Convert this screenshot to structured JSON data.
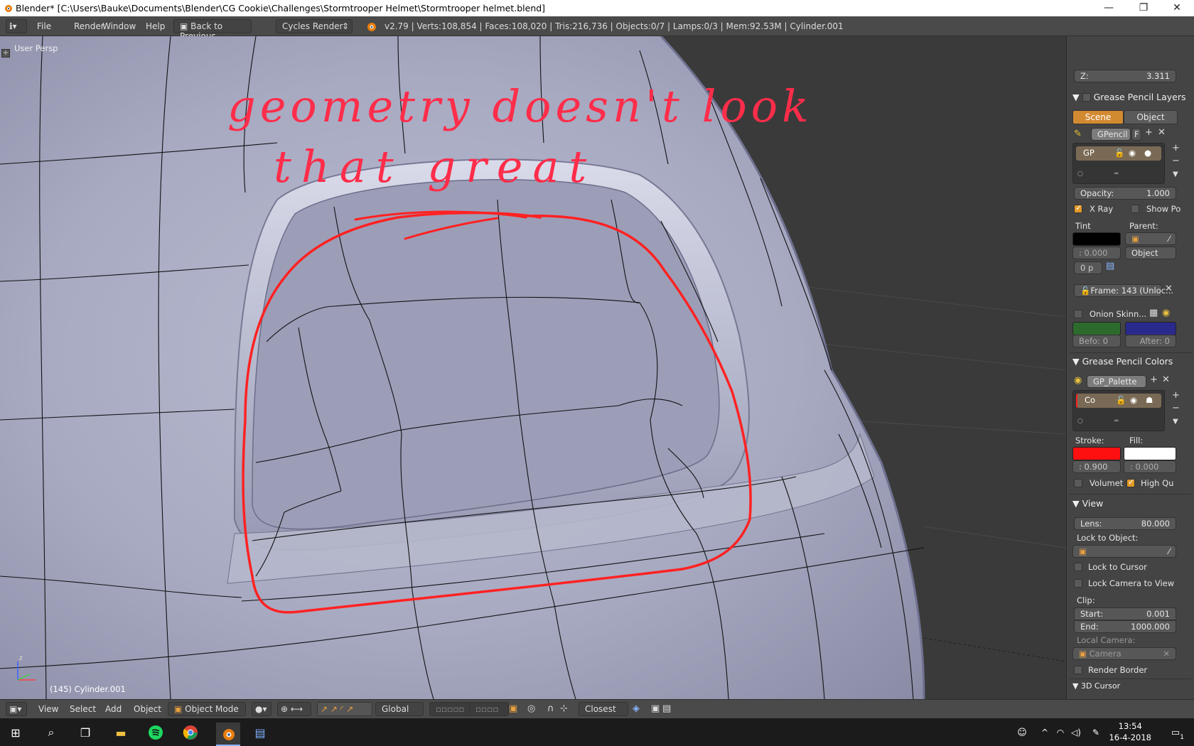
{
  "window": {
    "title": "Blender* [C:\\Users\\Bauke\\Documents\\Blender\\CG Cookie\\Challenges\\Stormtrooper Helmet\\Stormtrooper helmet.blend]",
    "minimize": "—",
    "maximize": "❐",
    "close": "✕"
  },
  "info_header": {
    "menus": [
      "File",
      "Render",
      "Window",
      "Help"
    ],
    "back_button": "Back to Previous",
    "engine": "Cycles Render",
    "stats": "v2.79 | Verts:108,854 | Faces:108,020 | Tris:216,736 | Objects:0/7 | Lamps:0/3 | Mem:92.53M | Cylinder.001"
  },
  "viewport": {
    "persp_label": "User Persp",
    "object_label": "(145) Cylinder.001",
    "annotation_line1": "geometry doesn't look",
    "annotation_line2": "that great",
    "stroke_color": "#ff2222"
  },
  "properties": {
    "z_field": {
      "label": "Z:",
      "value": "3.311"
    },
    "gp_layers": {
      "header": "Grease Pencil Layers",
      "tab_scene": "Scene",
      "tab_object": "Object",
      "datablock": "GPencil",
      "datablock_f": "F",
      "layer_name": "GP",
      "opacity_label": "Opacity:",
      "opacity_value": "1.000",
      "xray_label": "X Ray",
      "show_points_label": "Show Po",
      "tint_label": "Tint",
      "parent_label": "Parent:",
      "tint_value": ": 0.000",
      "parent_type": "Object",
      "thickness_value": "0 p",
      "frame_label": "Frame: 143 (Unloc...",
      "onion_label": "Onion Skinn...",
      "before_label": "Befo: 0",
      "after_label": "After: 0"
    },
    "gp_colors": {
      "header": "Grease Pencil Colors",
      "palette": "GP_Palette",
      "color_name": "Co",
      "stroke_label": "Stroke:",
      "fill_label": "Fill:",
      "stroke_alpha": ": 0.900",
      "fill_alpha": ": 0.000",
      "stroke_color": "#ff1010",
      "fill_color": "#ffffff",
      "volumetric_label": "Volumet",
      "high_quality_label": "High Qu"
    },
    "view": {
      "header": "View",
      "lens_label": "Lens:",
      "lens_value": "80.000",
      "lock_object_label": "Lock to Object:",
      "lock_cursor_label": "Lock to Cursor",
      "lock_camera_label": "Lock Camera to View",
      "clip_label": "Clip:",
      "start_label": "Start:",
      "start_value": "0.001",
      "end_label": "End:",
      "end_value": "1000.000",
      "local_camera_label": "Local Camera:",
      "camera_placeholder": "Camera",
      "render_border_label": "Render Border",
      "cursor_header": "3D Cursor"
    }
  },
  "bottom_header": {
    "menus": [
      "View",
      "Select",
      "Add",
      "Object"
    ],
    "mode": "Object Mode",
    "orientation": "Global",
    "snap": "Closest"
  },
  "taskbar": {
    "time": "13:54",
    "date": "16-4-2018",
    "notif": "1"
  }
}
